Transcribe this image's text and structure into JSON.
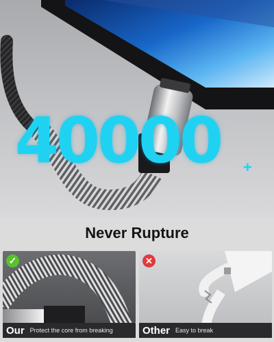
{
  "hero": {
    "big_number": "40000",
    "plus": "+"
  },
  "headline": "Never Rupture",
  "panels": {
    "ours": {
      "label": "Our",
      "text": "Protect the core from breaking",
      "badge": "✓"
    },
    "other": {
      "label": "Other",
      "text": "Easy to break",
      "badge": "✕"
    }
  },
  "colors": {
    "accent_number": "#1fd2f2",
    "good": "#57c22a",
    "bad": "#e23a3a"
  }
}
